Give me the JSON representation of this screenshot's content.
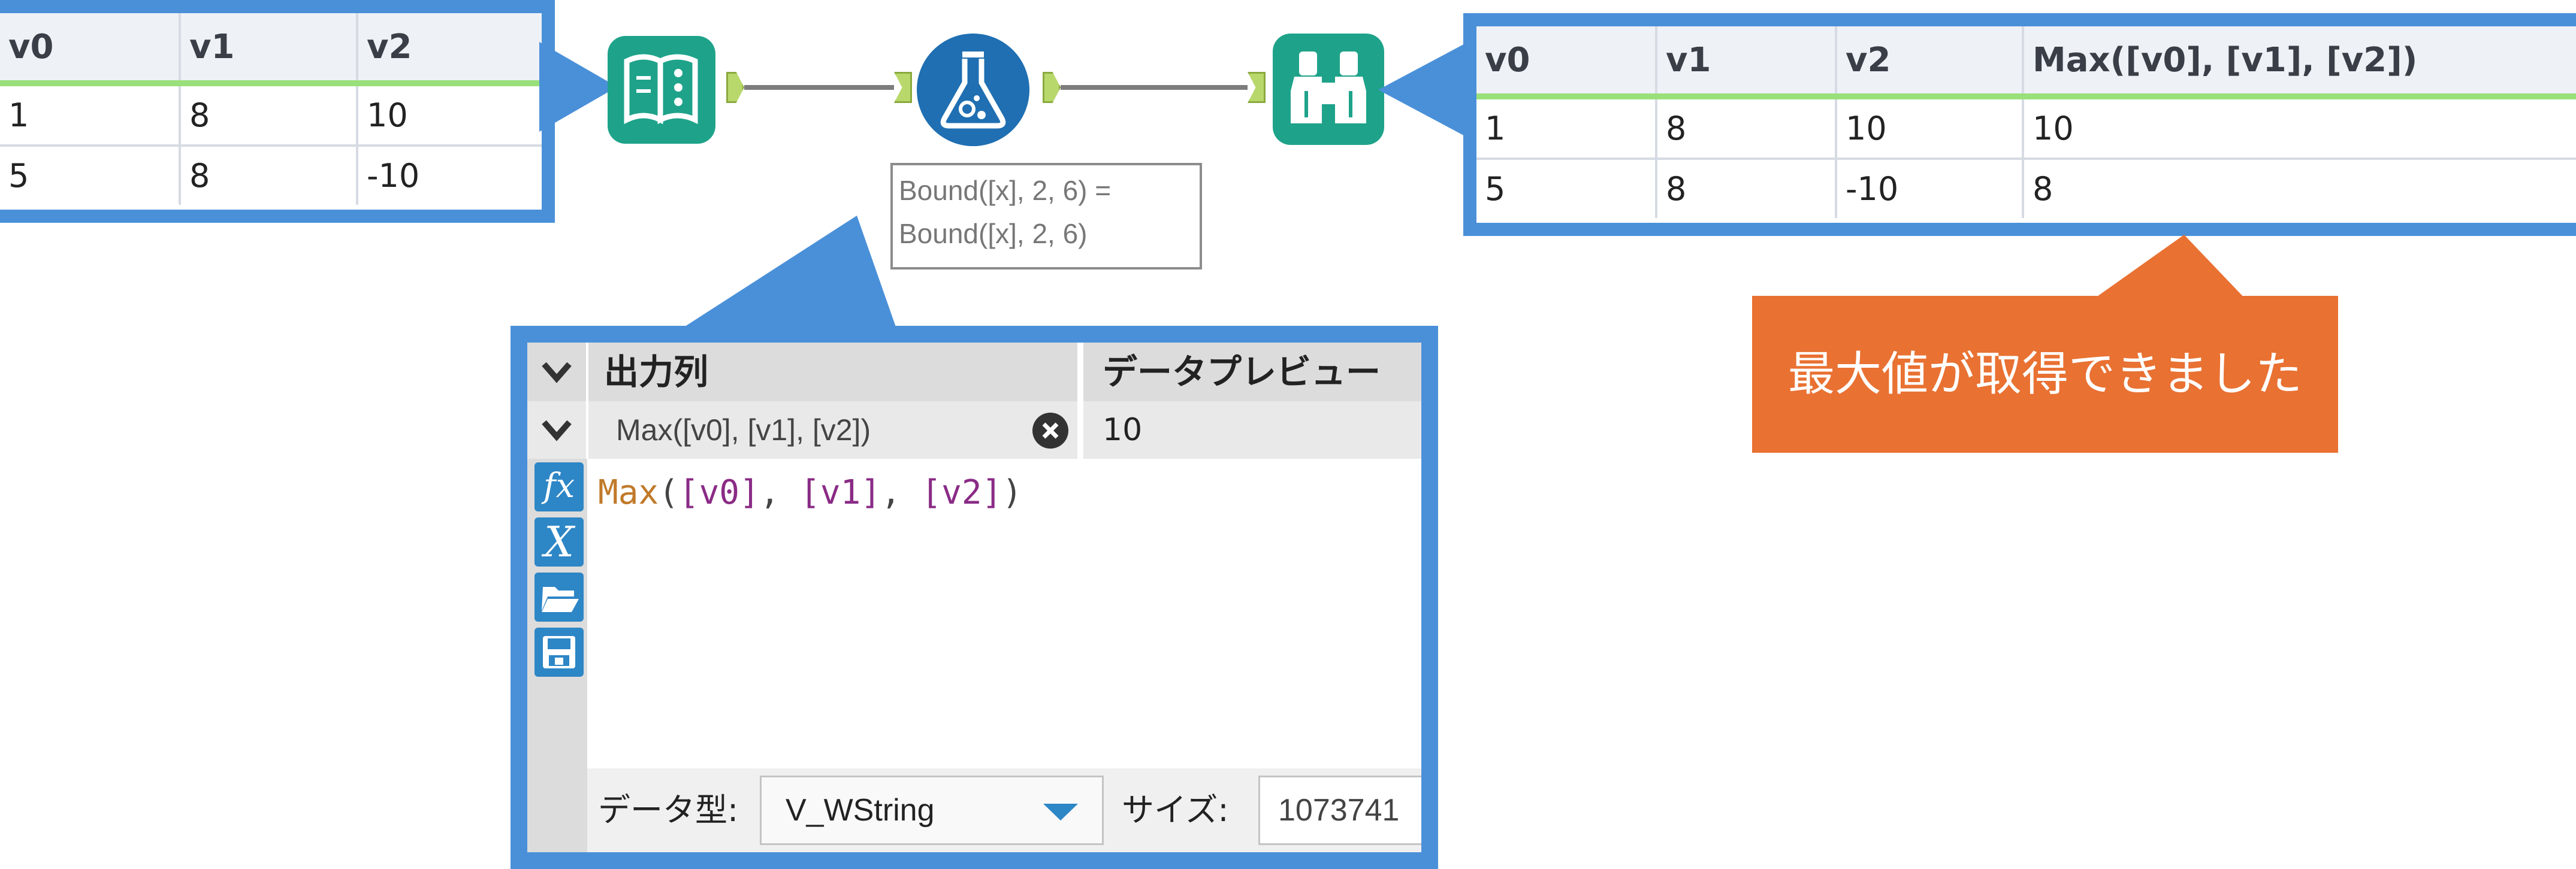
{
  "input_grid": {
    "columns": [
      "v0",
      "v1",
      "v2"
    ],
    "rows": [
      [
        "1",
        "8",
        "10"
      ],
      [
        "5",
        "8",
        "-10"
      ]
    ]
  },
  "output_grid": {
    "columns": [
      "v0",
      "v1",
      "v2",
      "Max([v0], [v1], [v2])"
    ],
    "rows": [
      [
        "1",
        "8",
        "10",
        "10"
      ],
      [
        "5",
        "8",
        "-10",
        "8"
      ]
    ]
  },
  "annotation": {
    "line1": "Bound([x], 2, 6) =",
    "line2": "Bound([x], 2, 6)"
  },
  "formula_panel": {
    "header_output_column": "出力列",
    "header_data_preview": "データプレビュー",
    "field_name": "Max([v0], [v1], [v2])",
    "preview_value": "10",
    "expression": {
      "func": "Max",
      "open": "(",
      "arg1": "[v0]",
      "sep1": ", ",
      "arg2": "[v1]",
      "sep2": ", ",
      "arg3": "[v2]",
      "close": ")"
    },
    "data_type_label": "データ型:",
    "data_type_value": "V_WString",
    "size_label": "サイズ:",
    "size_value": "1073741"
  },
  "callout_note": "最大値が取得できました",
  "icons": {
    "input": "book-input-icon",
    "formula": "flask-formula-icon",
    "browse": "binoculars-browse-icon",
    "fx": "fx-icon",
    "variable": "variable-x-icon",
    "open": "folder-open-icon",
    "save": "floppy-save-icon",
    "clear": "clear-x-icon",
    "dropdown": "dropdown-arrow-icon",
    "collapse": "chevron-down-icon"
  },
  "colors": {
    "frame": "#4a90d9",
    "input_tool": "#1ea38a",
    "formula_tool": "#1f6fb2",
    "note": "#e97132",
    "func": "#c07a2a",
    "field": "#8a2b86"
  }
}
